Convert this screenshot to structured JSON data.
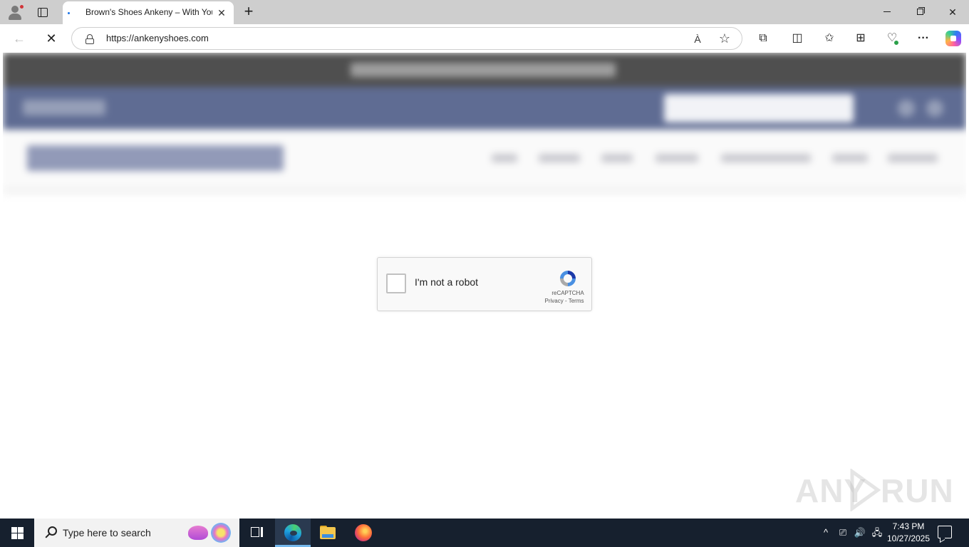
{
  "browser": {
    "tab": {
      "title": "Brown's Shoes Ankeny – With You",
      "close_glyph": "✕"
    },
    "new_tab_glyph": "+",
    "window_controls": {
      "close_glyph": "✕"
    },
    "address_bar": {
      "url": "https://ankenyshoes.com",
      "back_glyph": "←",
      "stop_glyph": "✕",
      "read_aloud_glyph": "À",
      "favorite_glyph": "☆"
    },
    "toolbar": {
      "extensions_glyph": "⧉",
      "split_screen_glyph": "◫",
      "favorites_glyph": "✩",
      "collections_glyph": "⊞",
      "performance_glyph": "♡",
      "more_glyph": "···"
    }
  },
  "page": {
    "recaptcha": {
      "label": "I'm not a robot",
      "brand": "reCAPTCHA",
      "links": "Privacy - Terms"
    },
    "watermark": {
      "left": "ANY",
      "right": "RUN"
    }
  },
  "taskbar": {
    "search_placeholder": "Type here to search",
    "tray": {
      "chevron": "^",
      "meet": "⎚",
      "volume": "🔊",
      "network": "🖧"
    },
    "time": "7:43 PM",
    "date": "10/27/2025"
  }
}
